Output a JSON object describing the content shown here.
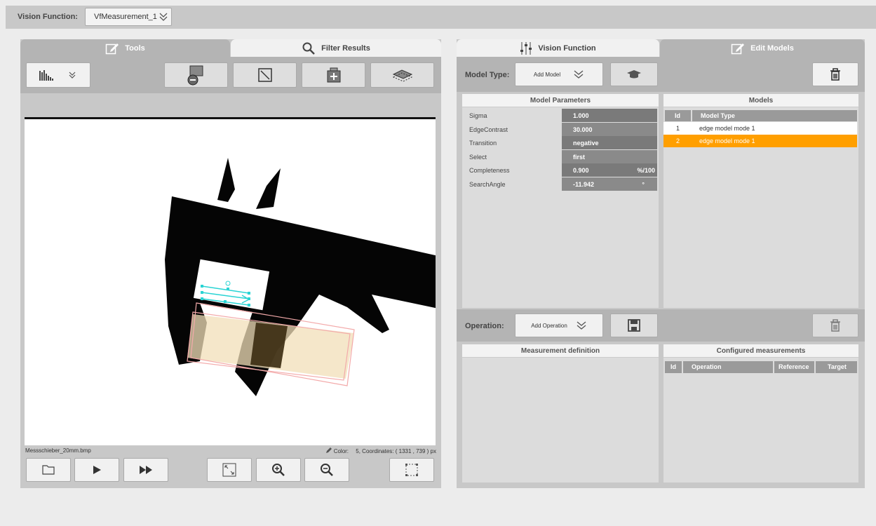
{
  "header": {
    "vision_function_label": "Vision Function:",
    "vision_function_value": "VfMeasurement_1"
  },
  "left_panel": {
    "tabs": [
      {
        "label": "Tools",
        "active": true
      },
      {
        "label": "Filter Results",
        "active": false
      }
    ],
    "image_filename": "Messschieber_20mm.bmp",
    "status_color_label": "Color:",
    "status_coordinates": "5, Coordinates: ( 1331 ,    739 ) px"
  },
  "right_panel": {
    "tabs": [
      {
        "label": "Vision Function",
        "active": false
      },
      {
        "label": "Edit Models",
        "active": true
      }
    ],
    "model_type_label": "Model Type:",
    "add_model_label": "Add Model",
    "model_parameters": {
      "title": "Model Parameters",
      "rows": [
        {
          "name": "Sigma",
          "value": "1.000",
          "unit": ""
        },
        {
          "name": "EdgeContrast",
          "value": "30.000",
          "unit": ""
        },
        {
          "name": "Transition",
          "value": "negative",
          "unit": ""
        },
        {
          "name": "Select",
          "value": "first",
          "unit": ""
        },
        {
          "name": "Completeness",
          "value": "0.900",
          "unit": "%/100"
        },
        {
          "name": "SearchAngle",
          "value": "-11.942",
          "unit": "°"
        }
      ]
    },
    "models": {
      "title": "Models",
      "columns": [
        "Id",
        "Model Type"
      ],
      "rows": [
        {
          "id": "1",
          "type": "edge model mode 1",
          "selected": false
        },
        {
          "id": "2",
          "type": "edge model mode 1",
          "selected": true
        }
      ]
    },
    "operation_label": "Operation:",
    "add_operation_label": "Add Operation",
    "measurement_definition": {
      "title": "Measurement definition"
    },
    "configured_measurements": {
      "title": "Configured measurements",
      "columns": [
        "Id",
        "Operation",
        "Reference",
        "Target"
      ]
    }
  },
  "colors": {
    "accent": "#ff9f00",
    "panel": "#c8c8c8",
    "active_tab": "#b4b4b4",
    "value_cell": "#7a7a7a",
    "roi_cyan": "#2ad4d4"
  }
}
